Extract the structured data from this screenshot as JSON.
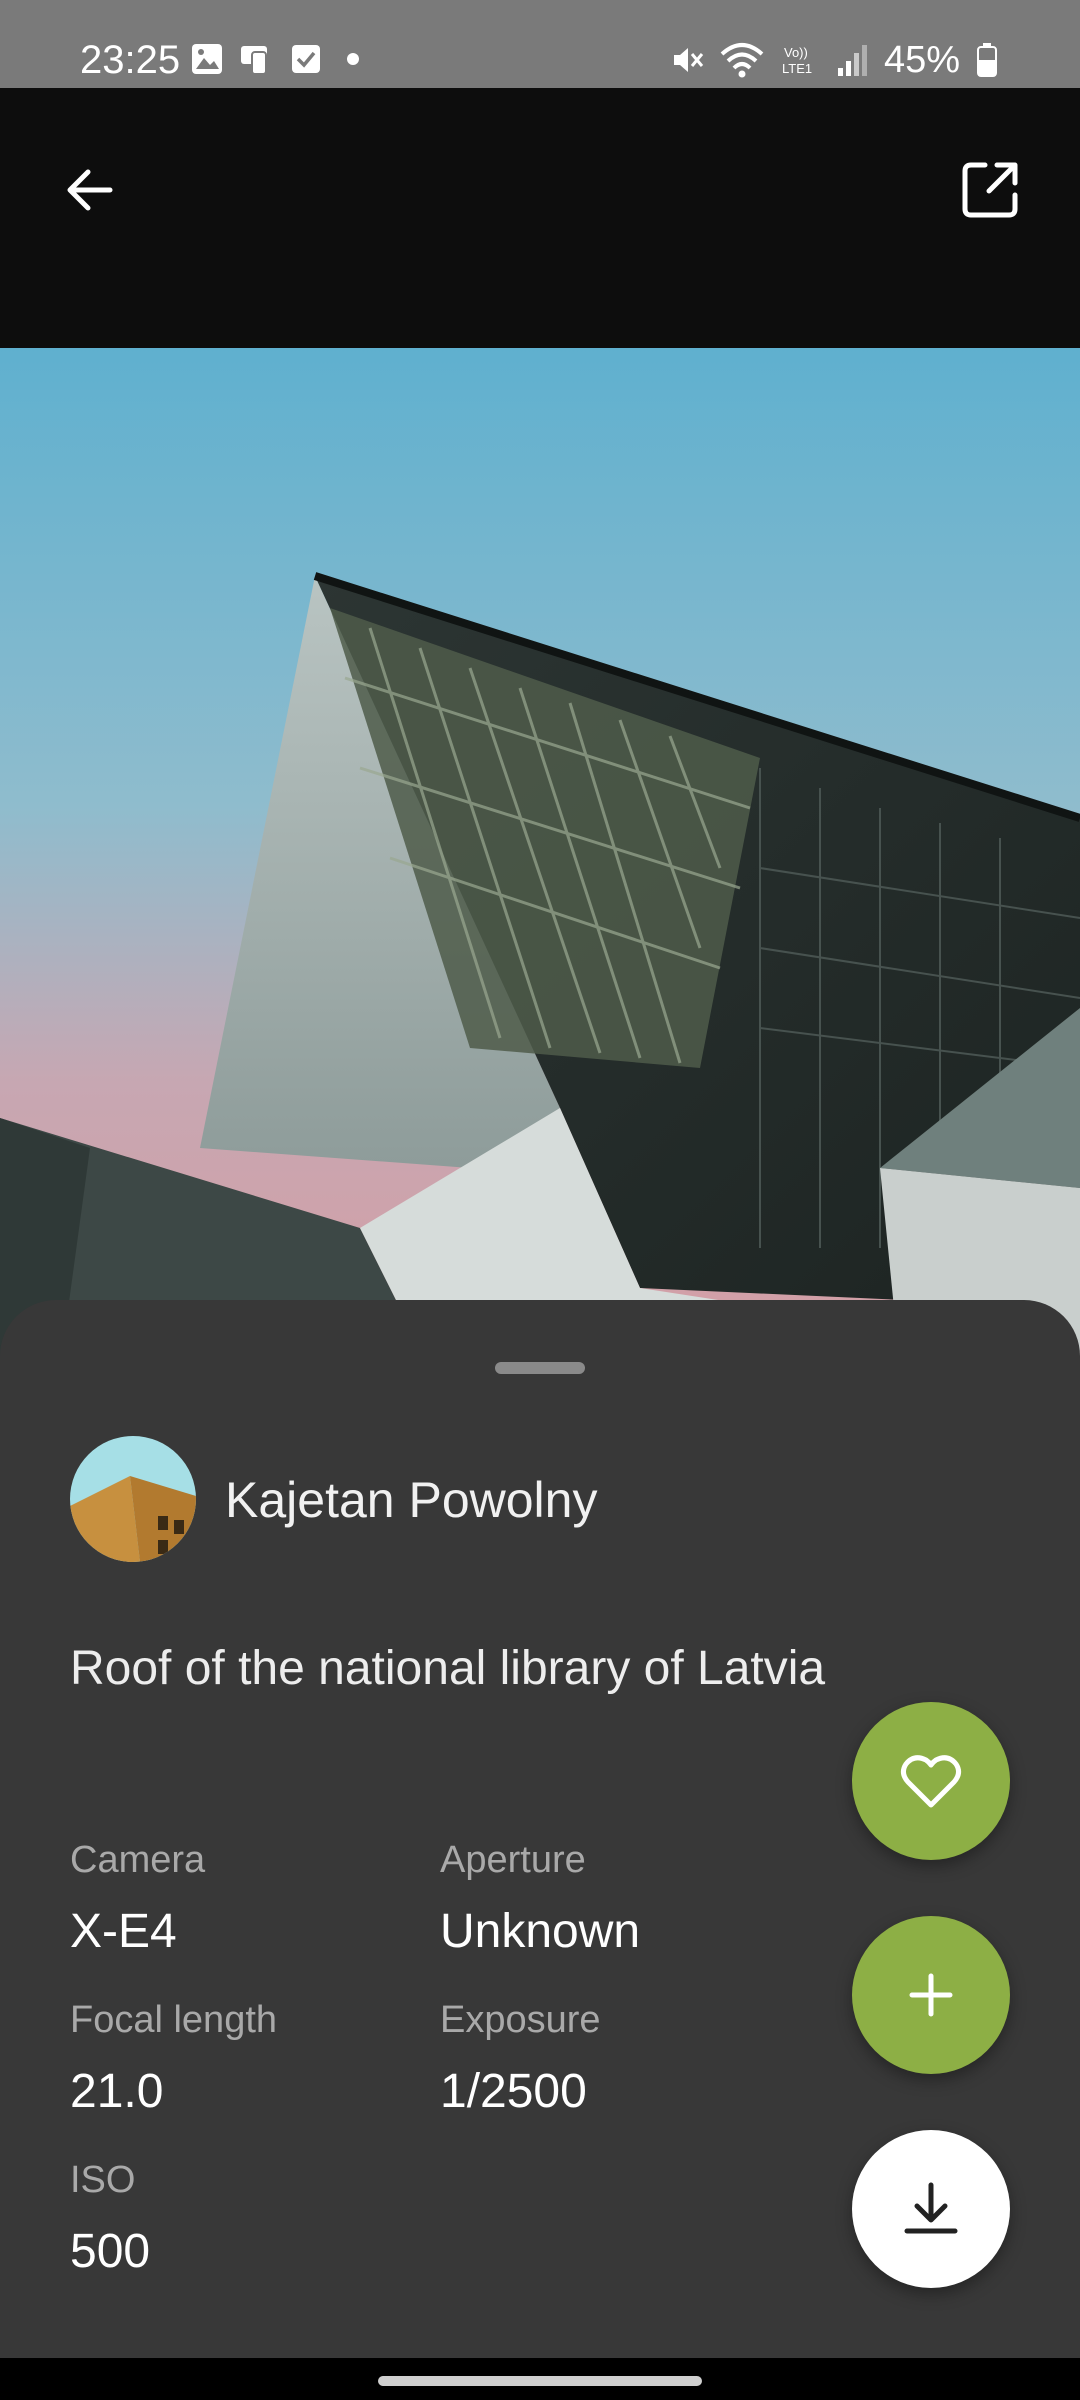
{
  "status_bar": {
    "time": "23:25",
    "battery": "45%",
    "icons_left": [
      "gallery-icon",
      "device-icon",
      "checkbox-icon",
      "dot-icon"
    ],
    "icons_right": [
      "mute-icon",
      "wifi-icon",
      "volte-icon",
      "signal-icon",
      "battery-icon"
    ]
  },
  "toolbar": {
    "back_icon": "arrow-left-icon",
    "share_icon": "open-external-icon"
  },
  "photo": {
    "subject": "modern building roof against blue sky"
  },
  "sheet": {
    "author": "Kajetan Powolny",
    "title": "Roof of the national library of Latvia",
    "details": {
      "camera_label": "Camera",
      "camera_value": "X-E4",
      "aperture_label": "Aperture",
      "aperture_value": "Unknown",
      "focal_label": "Focal length",
      "focal_value": "21.0",
      "exposure_label": "Exposure",
      "exposure_value": "1/2500",
      "iso_label": "ISO",
      "iso_value": "500"
    }
  },
  "actions": {
    "like_icon": "heart-outline-icon",
    "add_icon": "plus-icon",
    "download_icon": "download-icon"
  },
  "colors": {
    "accent": "#8daf45",
    "sheet_bg": "#383838",
    "topbar_bg": "#0d0d0d"
  }
}
